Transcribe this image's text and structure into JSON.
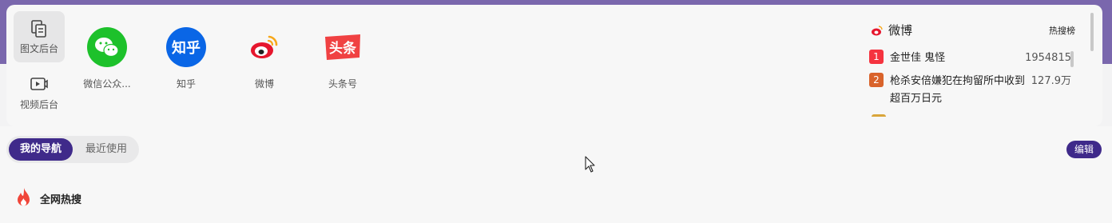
{
  "sidebar": {
    "items": [
      {
        "label": "图文后台",
        "icon": "document-copy-icon"
      },
      {
        "label": "视频后台",
        "icon": "video-play-icon"
      }
    ]
  },
  "apps": [
    {
      "name": "微信公众...",
      "icon": "wechat-icon",
      "color": "#1dc12b"
    },
    {
      "name": "知乎",
      "icon": "zhihu-icon",
      "color": "#0a66e6",
      "logo_text": "知乎"
    },
    {
      "name": "微博",
      "icon": "weibo-icon",
      "color": "#e6162d"
    },
    {
      "name": "头条号",
      "icon": "toutiao-icon",
      "color": "#f04142",
      "logo_text": "头条"
    }
  ],
  "hot": {
    "title": "微博",
    "tab": "热搜榜",
    "items": [
      {
        "rank": "1",
        "text": "金世佳 鬼怪",
        "value": "1954815",
        "color": "#f5333f"
      },
      {
        "rank": "2",
        "text": "枪杀安倍嫌犯在拘留所中收到超百万日元",
        "value": "127.9万",
        "color": "#d9632b"
      }
    ]
  },
  "nav_tabs": {
    "active": "我的导航",
    "inactive": "最近使用"
  },
  "edit_label": "编辑",
  "section": {
    "title": "全网热搜",
    "icon": "flame-icon"
  },
  "colors": {
    "accent": "#3f2a8a",
    "top_band": "#7a67ad"
  }
}
